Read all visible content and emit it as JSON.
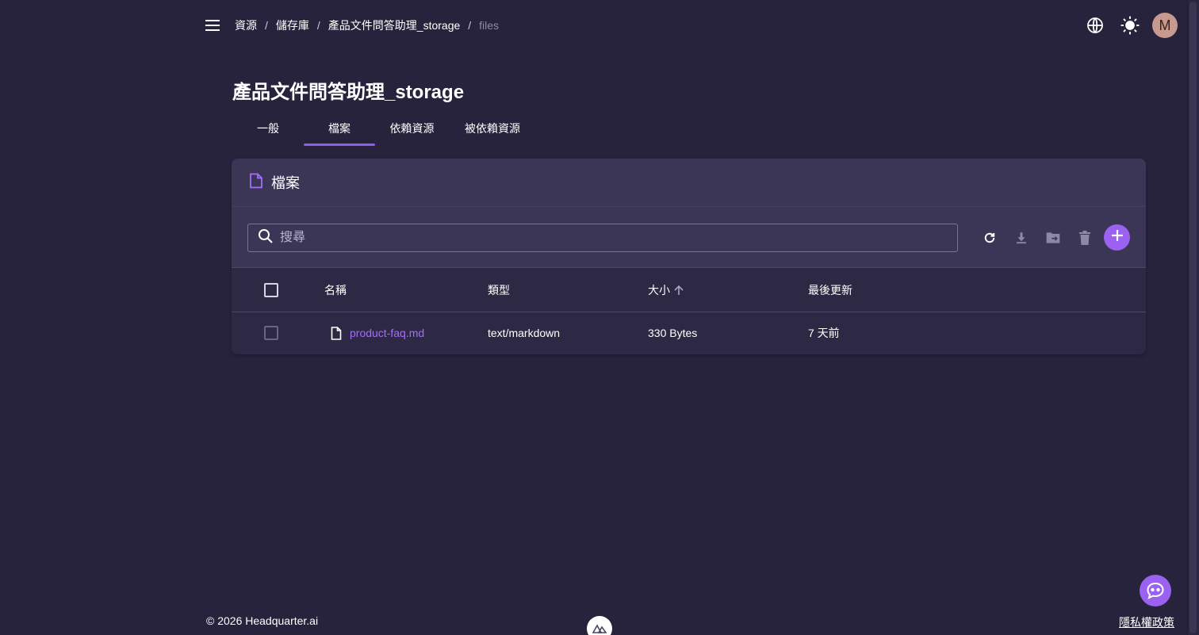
{
  "breadcrumb": [
    {
      "label": "資源"
    },
    {
      "label": "儲存庫"
    },
    {
      "label": "產品文件問答助理_storage"
    },
    {
      "label": "files"
    }
  ],
  "header": {
    "avatar_initial": "M",
    "icons": [
      "menu-icon",
      "globe-icon",
      "sun-icon"
    ]
  },
  "page": {
    "title": "產品文件問答助理_storage"
  },
  "tabs": [
    {
      "label": "一般",
      "active": false
    },
    {
      "label": "檔案",
      "active": true
    },
    {
      "label": "依賴資源",
      "active": false
    },
    {
      "label": "被依賴資源",
      "active": false
    }
  ],
  "card": {
    "title": "檔案",
    "search_placeholder": "搜尋",
    "toolbar_icons": [
      "refresh-icon",
      "download-icon",
      "move-to-folder-icon",
      "delete-icon",
      "add-icon"
    ]
  },
  "table": {
    "columns": [
      {
        "label": "名稱"
      },
      {
        "label": "類型"
      },
      {
        "label": "大小",
        "sort": "ascending"
      },
      {
        "label": "最後更新"
      }
    ],
    "rows": [
      {
        "name": "product-faq.md",
        "type": "text/markdown",
        "size": "330 Bytes",
        "updated": "7 天前"
      }
    ]
  },
  "footer": {
    "copyright": "© 2026 Headquarter.ai",
    "privacy": "隱私權政策"
  },
  "colors": {
    "background": "#27233c",
    "card": "#2d2945",
    "card_header": "#3c3656",
    "accent": "#9b62f2",
    "link": "#a46ef7"
  }
}
